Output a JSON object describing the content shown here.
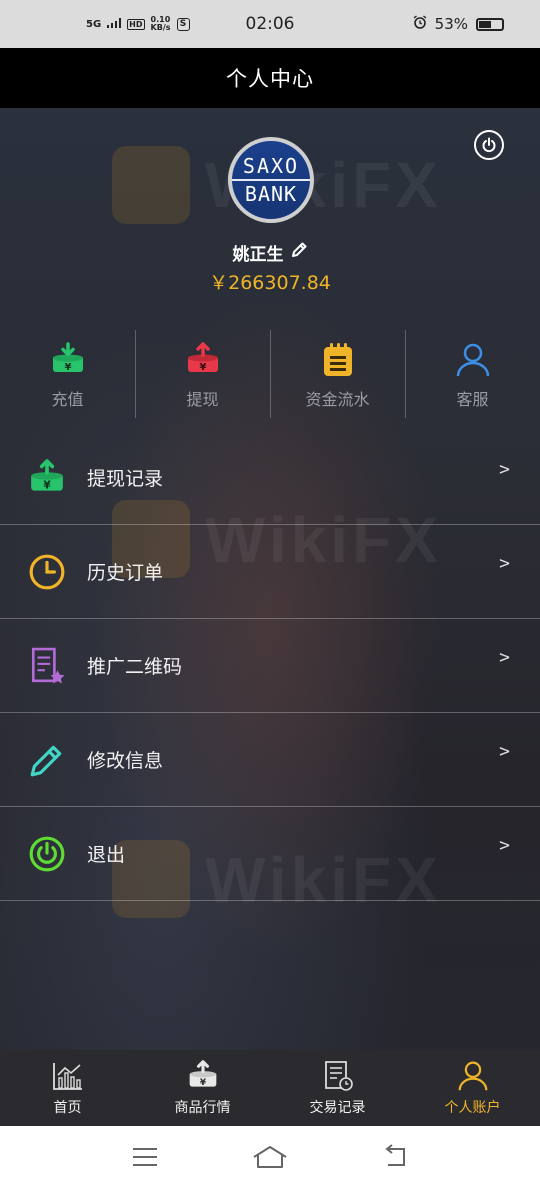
{
  "status_bar": {
    "network": "5G",
    "speed": "0.10",
    "speed_unit": "KB/s",
    "time": "02:06",
    "battery": "53%"
  },
  "header": {
    "title": "个人中心"
  },
  "profile": {
    "avatar_line1": "SAXO",
    "avatar_line2": "BANK",
    "username": "姚正生",
    "balance": "￥266307.84"
  },
  "quick_actions": [
    {
      "label": "充值",
      "icon": "deposit-icon",
      "color": "#27c46b"
    },
    {
      "label": "提现",
      "icon": "withdraw-icon",
      "color": "#e8394a"
    },
    {
      "label": "资金流水",
      "icon": "notepad-icon",
      "color": "#f0b429"
    },
    {
      "label": "客服",
      "icon": "user-icon",
      "color": "#3d8fe6"
    }
  ],
  "menu": [
    {
      "label": "提现记录",
      "icon": "withdraw-record-icon",
      "chevron": ">"
    },
    {
      "label": "历史订单",
      "icon": "clock-icon",
      "chevron": ">"
    },
    {
      "label": "推广二维码",
      "icon": "document-star-icon",
      "chevron": ">"
    },
    {
      "label": "修改信息",
      "icon": "pencil-icon",
      "chevron": ">"
    },
    {
      "label": "退出",
      "icon": "power-icon",
      "chevron": ">"
    }
  ],
  "bottom_nav": [
    {
      "label": "首页",
      "icon": "chart-icon",
      "active": false
    },
    {
      "label": "商品行情",
      "icon": "product-icon",
      "active": false
    },
    {
      "label": "交易记录",
      "icon": "receipt-icon",
      "active": false
    },
    {
      "label": "个人账户",
      "icon": "user-icon",
      "active": true
    }
  ],
  "colors": {
    "accent": "#f0b429",
    "green": "#27c46b",
    "red": "#e8394a",
    "blue": "#3d8fe6",
    "purple": "#b36bd8",
    "teal": "#3fd6c6",
    "power_green": "#5fdc34"
  }
}
